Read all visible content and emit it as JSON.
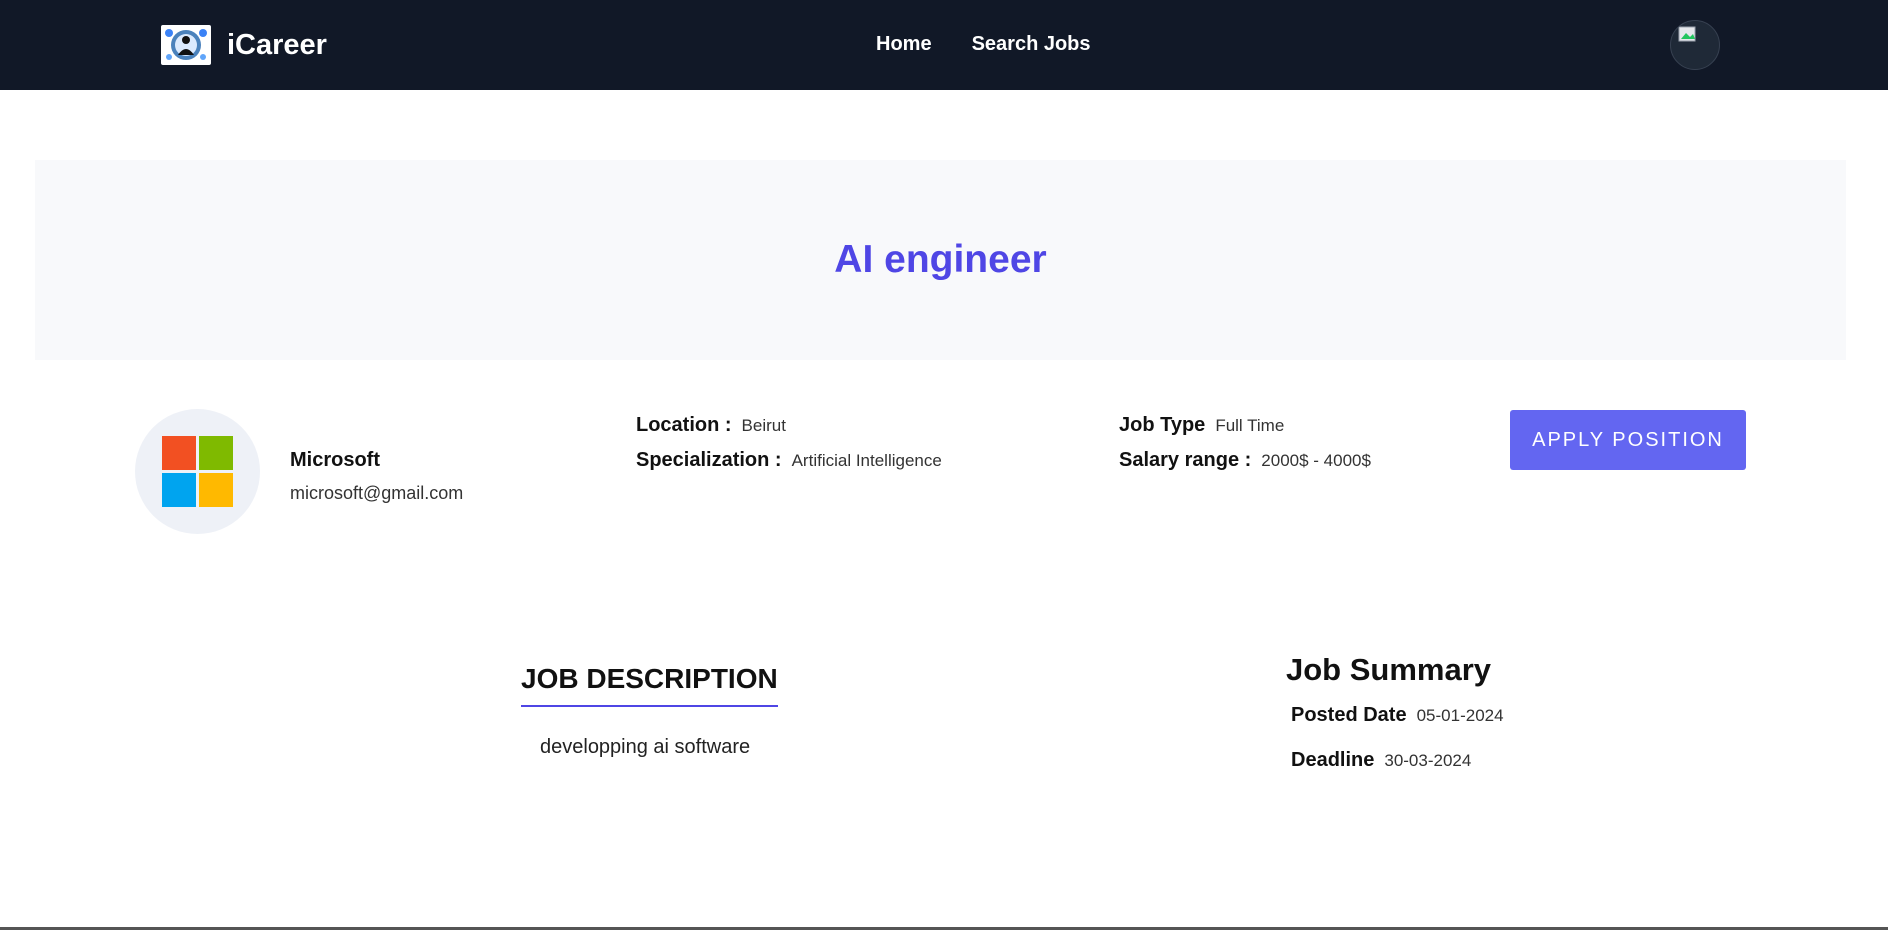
{
  "navbar": {
    "brand_name": "iCareer",
    "links": [
      {
        "label": "Home"
      },
      {
        "label": "Search Jobs"
      }
    ],
    "background": "#111827"
  },
  "job": {
    "title": "AI engineer",
    "title_color": "#4f46e5"
  },
  "company": {
    "name": "Microsoft",
    "email": "microsoft@gmail.com",
    "logo_colors": [
      "#f25022",
      "#7fba00",
      "#00a4ef",
      "#ffb900"
    ]
  },
  "details": {
    "location_label": "Location :",
    "location_value": "Beirut",
    "specialization_label": "Specialization :",
    "specialization_value": "Artificial Intelligence",
    "job_type_label": "Job Type",
    "job_type_value": "Full Time",
    "salary_label": "Salary range :",
    "salary_value": "2000$ - 4000$"
  },
  "apply_button": {
    "label": "APPLY POSITION",
    "color": "#6366f1"
  },
  "description": {
    "heading": "JOB DESCRIPTION",
    "text": "developping ai software"
  },
  "summary": {
    "heading": "Job Summary",
    "posted_label": "Posted Date",
    "posted_value": "05-01-2024",
    "deadline_label": "Deadline",
    "deadline_value": "30-03-2024"
  }
}
